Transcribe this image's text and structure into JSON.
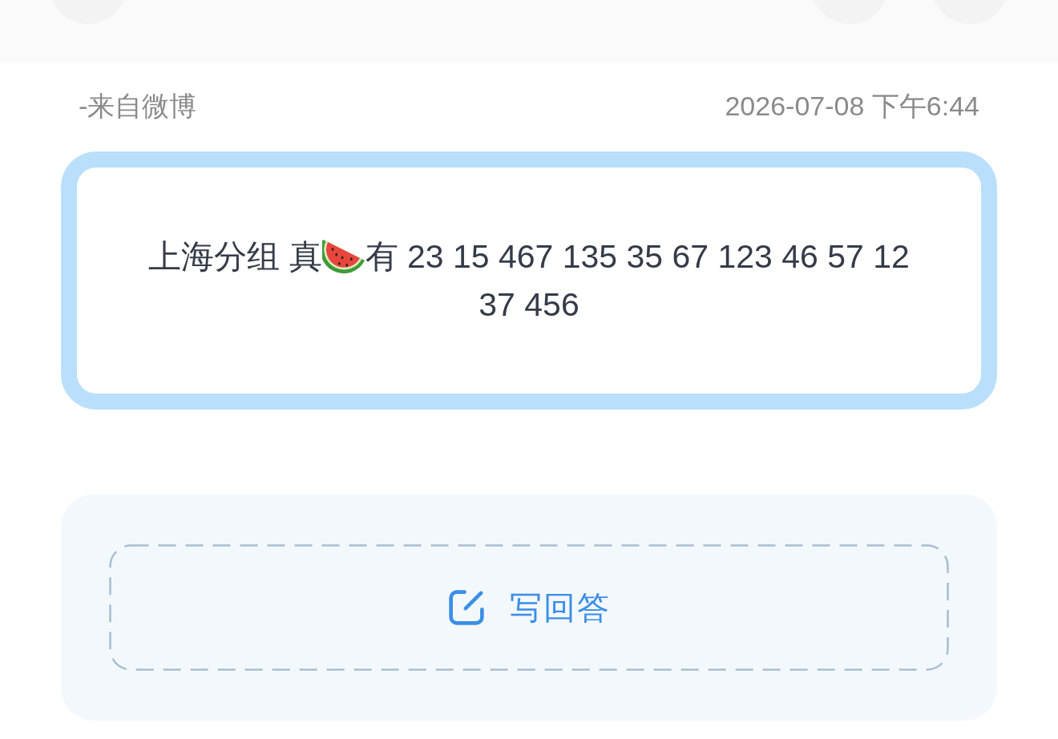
{
  "source": "-来自微博",
  "timestamp": "2026-07-08 下午6:44",
  "question": {
    "segments": [
      {
        "kind": "text",
        "text": "上海分组 真"
      },
      {
        "kind": "emoji"
      },
      {
        "kind": "text",
        "text": "有 23 15 467 135 35 67 123 46 57 12 37 456"
      }
    ]
  },
  "answer_panel": {
    "button_label": "写回答"
  }
}
